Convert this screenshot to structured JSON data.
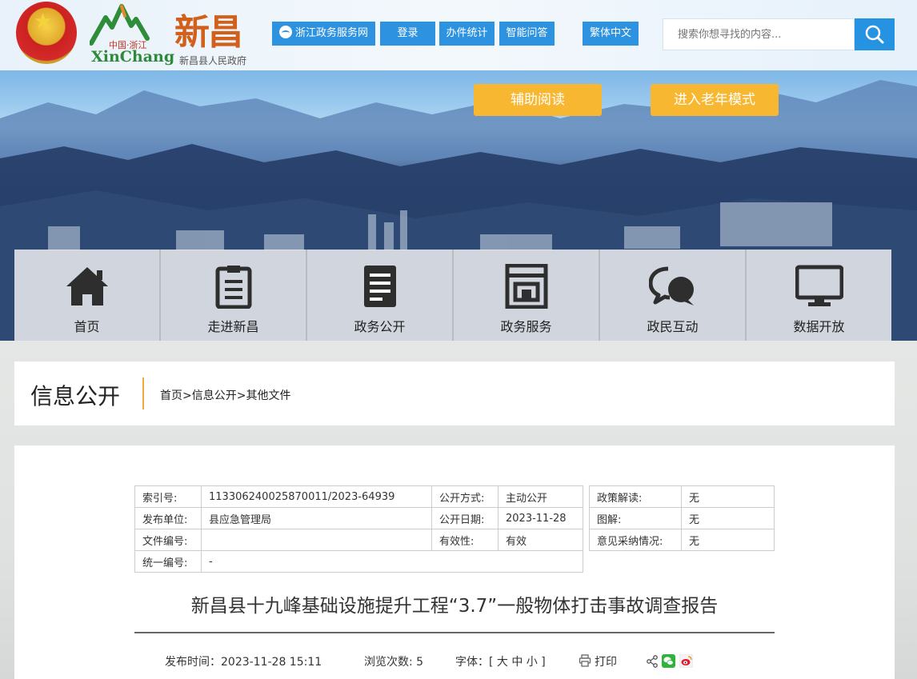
{
  "header": {
    "logo_region": "中国·浙江",
    "logo_en": "XinChang",
    "logo_cn": "新昌",
    "logo_sub": "新昌县人民政府",
    "buttons": [
      {
        "label": "浙江政务服务网"
      },
      {
        "label": "登录"
      },
      {
        "label": "办件统计"
      },
      {
        "label": "智能问答"
      },
      {
        "label": "繁体中文"
      }
    ],
    "search_placeholder": "搜索你想寻找的内容..."
  },
  "banner": {
    "assist_label": "辅助阅读",
    "elder_label": "进入老年模式"
  },
  "nav": [
    {
      "label": "首页",
      "icon": "home-icon"
    },
    {
      "label": "走进新昌",
      "icon": "clipboard-icon"
    },
    {
      "label": "政务公开",
      "icon": "document-icon"
    },
    {
      "label": "政务服务",
      "icon": "building-icon"
    },
    {
      "label": "政民互动",
      "icon": "chat-icon"
    },
    {
      "label": "数据开放",
      "icon": "monitor-icon"
    }
  ],
  "breadcrumb": {
    "title": "信息公开",
    "path": "首页>信息公开>其他文件"
  },
  "meta": {
    "index_label": "索引号:",
    "index_value": "113306240025870011/2023-64939",
    "open_method_label": "公开方式:",
    "open_method_value": "主动公开",
    "publisher_label": "发布单位:",
    "publisher_value": "县应急管理局",
    "open_date_label": "公开日期:",
    "open_date_value": "2023-11-28",
    "doc_no_label": "文件编号:",
    "doc_no_value": "",
    "validity_label": "有效性:",
    "validity_value": "有效",
    "unified_no_label": "统一编号:",
    "unified_no_value": "-",
    "policy_label": "政策解读:",
    "policy_value": "无",
    "graphic_label": "图解:",
    "graphic_value": "无",
    "opinion_label": "意见采纳情况:",
    "opinion_value": "无"
  },
  "article": {
    "title": "新昌县十九峰基础设施提升工程“3.7”一般物体打击事故调查报告",
    "publish_time": "发布时间：2023-11-28 15:11",
    "views": "浏览次数: 5",
    "font_size": "字体：[ 大 中 小 ]",
    "print_label": "打印"
  },
  "colors": {
    "top_button": "#2d92e0",
    "yellow_button": "#f7b731",
    "accent_line": "#f2a93b"
  }
}
